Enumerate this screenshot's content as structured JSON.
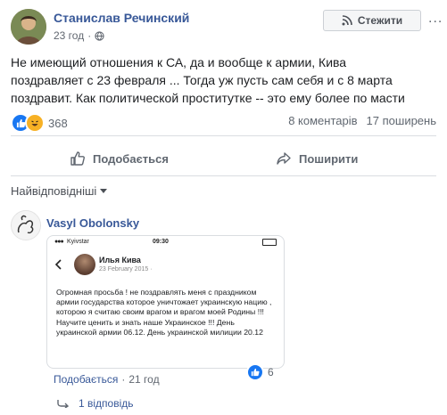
{
  "post": {
    "author": "Станислав Речинский",
    "time": "23 год",
    "dot": "·",
    "follow_label": "Стежити",
    "more_label": "...",
    "text_lines": [
      "Не имеющий отношения к СА, да и вообще к армии, Кива",
      "поздравляет с 23 февраля ... Тогда уж пусть сам себя и с 8 марта",
      "поздравит. Как политической проститутке -- это ему более по масти"
    ],
    "reaction_count": "368",
    "comments_count": "8 коментарів",
    "shares_count": "17 поширень"
  },
  "actions": {
    "like_label": "Подобається",
    "share_label": "Поширити"
  },
  "comments": {
    "sort_label": "Найвідповідніші",
    "first": {
      "author": "Vasyl Obolonsky",
      "screenshot": {
        "carrier": "Kyivstar",
        "clock": "09:30",
        "name": "Илья Кива",
        "date": "23 February 2015",
        "globe": "·",
        "text": "Огромная просьба ! не поздравлять меня с праздником армии государства которое уничтожает украинскую нацию , которою я считаю своим врагом и врагом моей Родины !!! Научите ценить и знать наше Украинское !!! День украинской армии 06.12. День украинской милиции 20.12"
      },
      "like_count": "6",
      "like_action": "Подобається",
      "sep": "·",
      "time": "21 год",
      "replies_label": "1 відповідь"
    }
  },
  "colors": {
    "link": "#385898",
    "like_blue": "#1877f2",
    "haha_yellow": "#f7b125"
  }
}
